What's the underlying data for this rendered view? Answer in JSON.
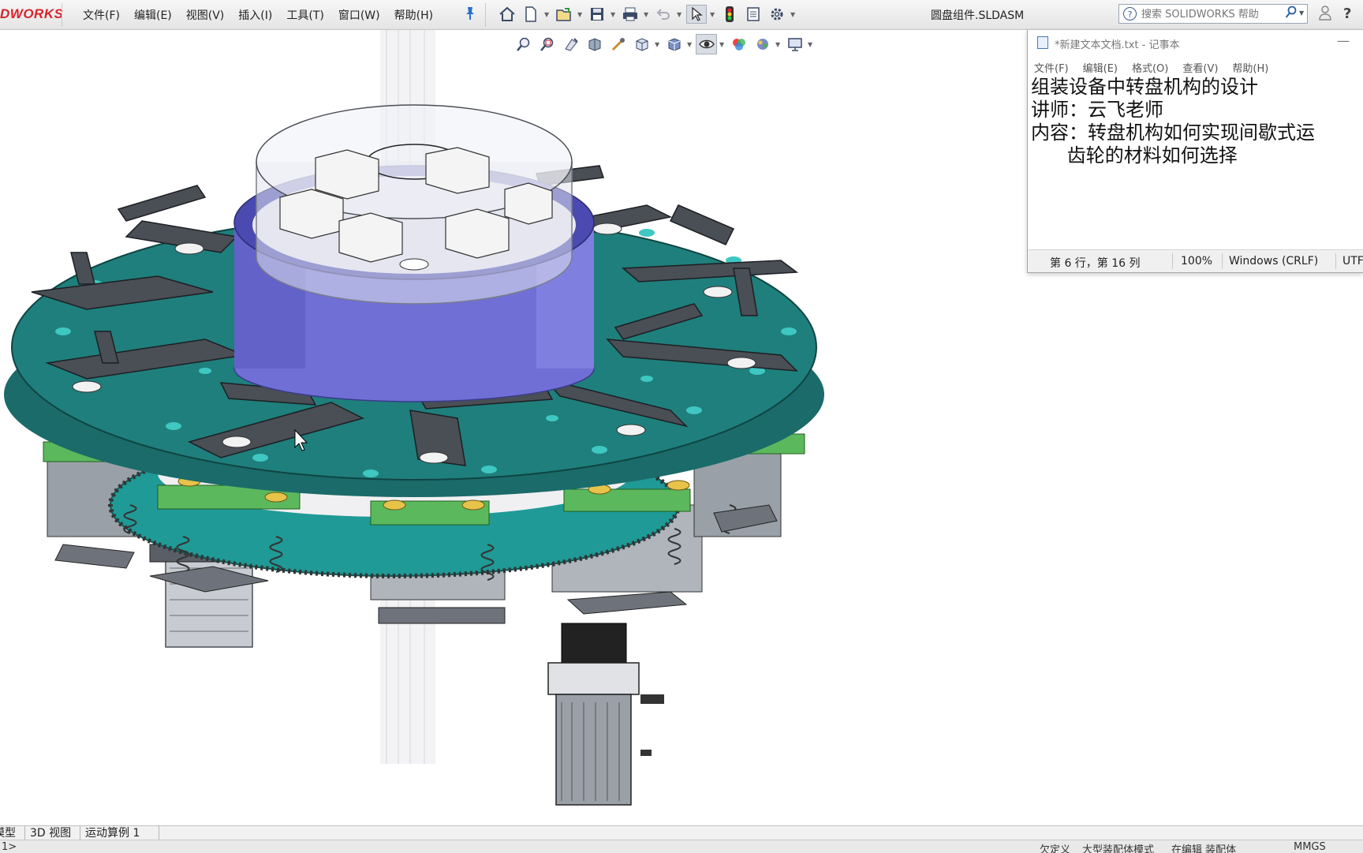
{
  "app": {
    "logo_text": "DWORKS",
    "document_title": "圆盘组件.SLDASM",
    "menu": [
      "文件(F)",
      "编辑(E)",
      "视图(V)",
      "插入(I)",
      "工具(T)",
      "窗口(W)",
      "帮助(H)"
    ],
    "search_placeholder": "搜索 SOLIDWORKS 帮助",
    "toolbar_icons": [
      "home-icon",
      "new-document-icon",
      "open-icon",
      "save-icon",
      "print-icon",
      "undo-icon",
      "select-icon",
      "rebuild-icon",
      "file-properties-icon",
      "options-icon"
    ],
    "view_toolbar_icons": [
      "zoom-to-fit-icon",
      "zoom-to-area-icon",
      "previous-view-icon",
      "section-view-icon",
      "dynamic-annotation-icon",
      "view-orientation-icon",
      "display-style-icon",
      "hide-show-items-icon",
      "edit-appearance-icon",
      "apply-scene-icon",
      "view-settings-icon"
    ]
  },
  "notepad": {
    "title": "*新建文本文档.txt - 记事本",
    "menu": [
      "文件(F)",
      "编辑(E)",
      "格式(O)",
      "查看(V)",
      "帮助(H)"
    ],
    "lines": [
      "组装设备中转盘机构的设计",
      "",
      "讲师：云飞老师",
      "",
      "内容：转盘机构如何实现间歇式运",
      "      齿轮的材料如何选择"
    ],
    "status": {
      "position": "第 6 行，第 16 列",
      "zoom": "100%",
      "line_ending": "Windows (CRLF)",
      "encoding": "UTF"
    }
  },
  "tabs": [
    "模型",
    "3D 视图",
    "运动算例 1"
  ],
  "statusbar": {
    "left": "1>",
    "items": [
      "欠定义",
      "大型装配体模式",
      "在编辑 装配体"
    ],
    "units": "MMGS"
  },
  "colors": {
    "plate": "#1f7f7c",
    "drum": "#6f6fd6",
    "green_parts": "#5cb85c",
    "steel": "#4a4e55"
  }
}
